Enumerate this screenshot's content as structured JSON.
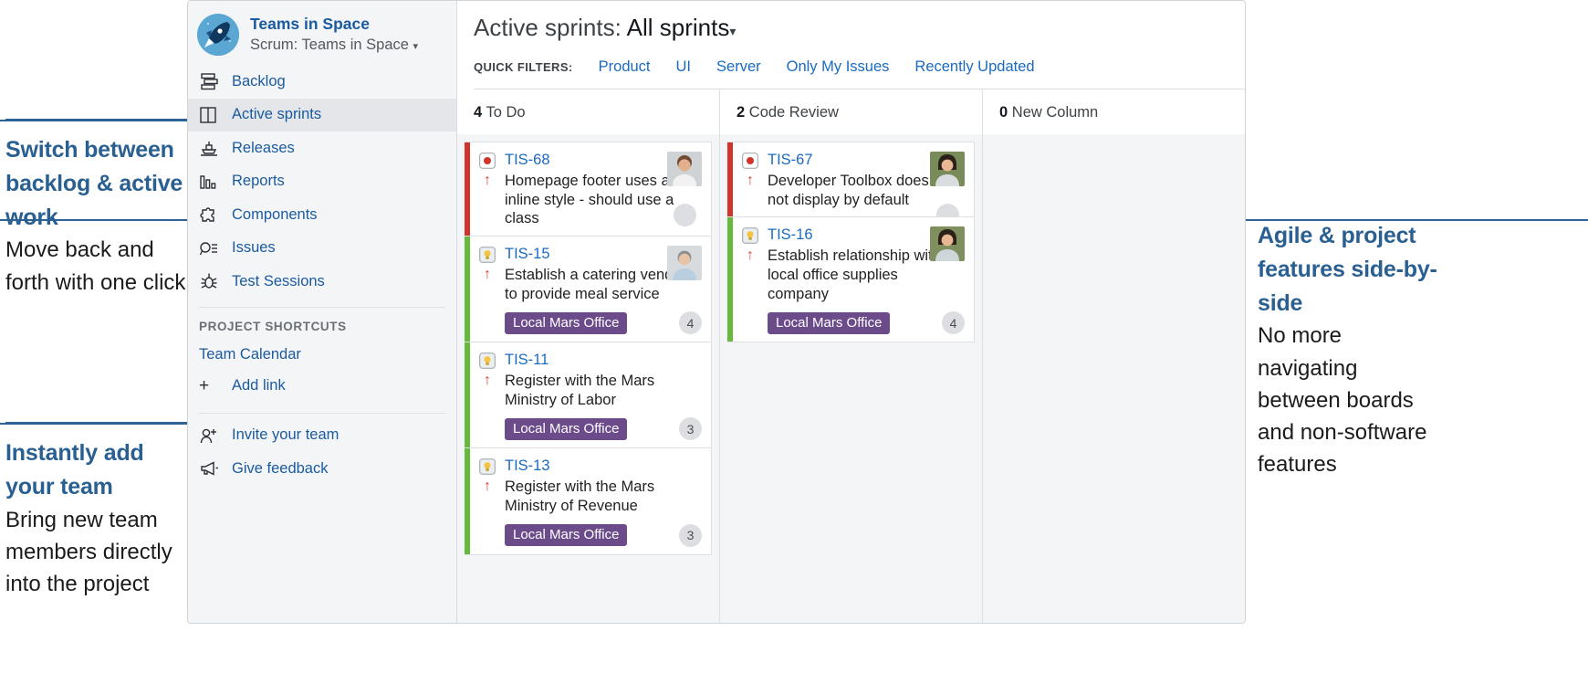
{
  "annotations": {
    "left": [
      {
        "title": "Switch between backlog & active work",
        "body": "Move back and forth with one click"
      },
      {
        "title": "Instantly add your team",
        "body": "Bring new team members directly into the project"
      }
    ],
    "right": [
      {
        "title": "Agile & project features side-by-side",
        "body": "No more navigating between boards and non-software features"
      }
    ]
  },
  "sidebar": {
    "project_name": "Teams in Space",
    "project_sub": "Scrum: Teams in Space",
    "project_sub_caret": "▾",
    "items": [
      {
        "label": "Backlog",
        "icon": "backlog-icon",
        "active": false
      },
      {
        "label": "Active sprints",
        "icon": "board-columns-icon",
        "active": true
      },
      {
        "label": "Releases",
        "icon": "ship-icon",
        "active": false
      },
      {
        "label": "Reports",
        "icon": "bar-chart-icon",
        "active": false
      },
      {
        "label": "Components",
        "icon": "puzzle-piece-icon",
        "active": false
      },
      {
        "label": "Issues",
        "icon": "search-list-icon",
        "active": false
      },
      {
        "label": "Test Sessions",
        "icon": "bug-icon",
        "active": false
      }
    ],
    "shortcuts_heading": "PROJECT SHORTCUTS",
    "shortcuts": [
      {
        "label": "Team Calendar"
      }
    ],
    "add_link_label": "Add link",
    "add_link_plus": "+",
    "footer_items": [
      {
        "label": "Invite your team",
        "icon": "person-plus-icon"
      },
      {
        "label": "Give feedback",
        "icon": "megaphone-icon"
      }
    ]
  },
  "board": {
    "title_prefix": "Active sprints:",
    "title_selected": "All sprints",
    "title_caret": "▾",
    "quick_filters_label": "QUICK FILTERS:",
    "quick_filters": [
      "Product",
      "UI",
      "Server",
      "Only My Issues",
      "Recently Updated"
    ],
    "columns": [
      {
        "count": "4",
        "name": "To Do",
        "cards": [
          {
            "key": "TIS-68",
            "summary": "Homepage footer uses an inline style - should use a class",
            "type": "bug-icon",
            "bar_color": "#d0342c",
            "priority": "↑",
            "label": null,
            "estimate": null,
            "avatar": "avatar-male-young",
            "avatar_dot": true
          },
          {
            "key": "TIS-15",
            "summary": "Establish a catering vendor to provide meal service",
            "type": "story-icon",
            "bar_color": "#63ba3c",
            "priority": "↑",
            "label": "Local Mars Office",
            "estimate": "4",
            "avatar": "avatar-male-light",
            "avatar_dot": false
          },
          {
            "key": "TIS-11",
            "summary": "Register with the Mars Ministry of Labor",
            "type": "story-icon",
            "bar_color": "#63ba3c",
            "priority": "↑",
            "label": "Local Mars Office",
            "estimate": "3",
            "avatar": null,
            "avatar_dot": false
          },
          {
            "key": "TIS-13",
            "summary": "Register with the Mars Ministry of Revenue",
            "type": "story-icon",
            "bar_color": "#63ba3c",
            "priority": "↑",
            "label": "Local Mars Office",
            "estimate": "3",
            "avatar": null,
            "avatar_dot": false
          }
        ]
      },
      {
        "count": "2",
        "name": "Code Review",
        "cards": [
          {
            "key": "TIS-67",
            "summary": "Developer Toolbox does not display by default",
            "type": "bug-icon",
            "bar_color": "#d0342c",
            "priority": "↑",
            "label": null,
            "estimate": null,
            "avatar": "avatar-female-dark",
            "avatar_dot": true
          },
          {
            "key": "TIS-16",
            "summary": "Establish relationship with local office supplies company",
            "type": "story-icon",
            "bar_color": "#63ba3c",
            "priority": "↑",
            "label": "Local Mars Office",
            "estimate": "4",
            "avatar": "avatar-female-dark2",
            "avatar_dot": false
          }
        ]
      },
      {
        "count": "0",
        "name": "New Column",
        "cards": []
      }
    ]
  },
  "colors": {
    "accent_blue": "#2a6091",
    "link_blue": "#1a6ac0",
    "bug_red": "#d0342c",
    "story_green": "#63ba3c",
    "label_purple": "#6b4b8a"
  }
}
